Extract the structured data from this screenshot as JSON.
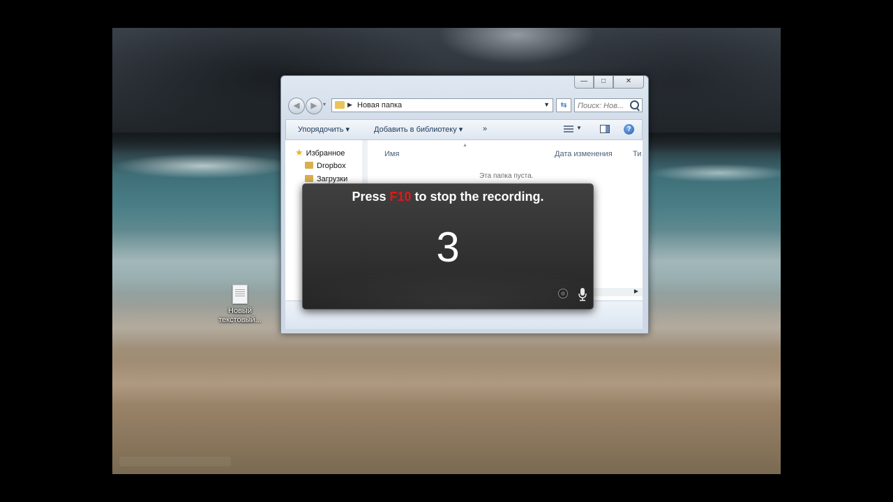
{
  "desktop": {
    "icons": [
      {
        "label_line1": "Новый",
        "label_line2": "текстовый..."
      }
    ]
  },
  "explorer": {
    "caption": {
      "minimize": "—",
      "maximize": "□",
      "close": "✕"
    },
    "nav": {
      "back": "◀",
      "forward": "▶"
    },
    "address": {
      "folder": "Новая папка"
    },
    "search": {
      "placeholder": "Поиск: Нов..."
    },
    "toolbar": {
      "organize": "Упорядочить ▾",
      "add_to_library": "Добавить в библиотеку ▾",
      "more": "»",
      "help": "?"
    },
    "nav_pane": {
      "favorites": "Избранное",
      "items": [
        "Dropbox",
        "Загрузки"
      ]
    },
    "columns": [
      "Имя",
      "Дата изменения",
      "Ти"
    ],
    "empty_message": "Эта папка пуста."
  },
  "recorder": {
    "message_before": "Press ",
    "key": "F10",
    "message_after": " to stop the recording.",
    "countdown": "3",
    "key_color": "#e01818"
  }
}
